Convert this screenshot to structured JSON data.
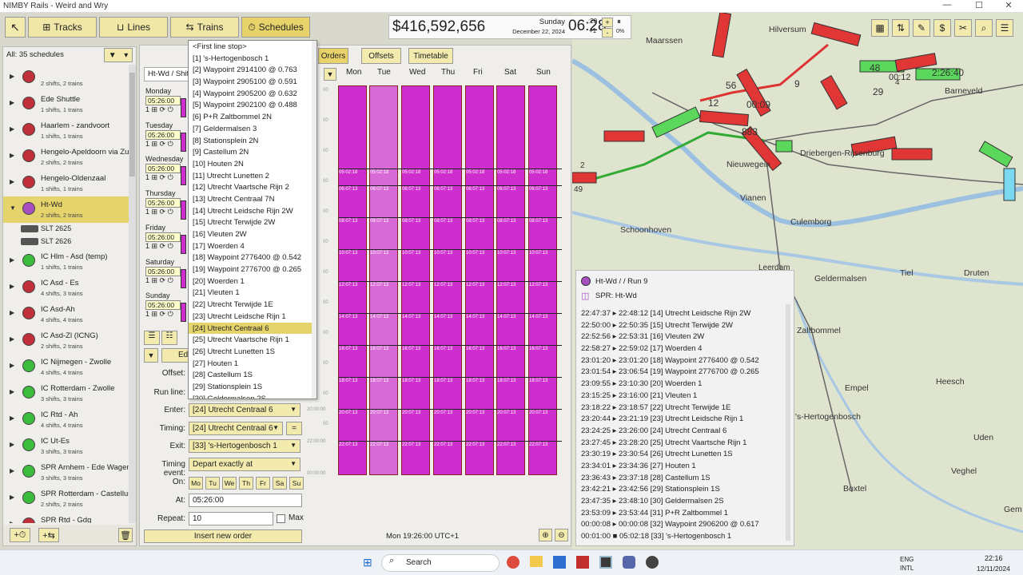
{
  "window": {
    "title": "NIMBY Rails - Weird and Wry"
  },
  "toolbar": {
    "tabs": [
      "Tracks",
      "Lines",
      "Trains",
      "Schedules"
    ],
    "active": "Schedules"
  },
  "finance": {
    "money": "$416,592,656",
    "weekday": "Sunday",
    "date": "December 22, 2024",
    "time": "06:28",
    "seconds": ":20",
    "speed": "+1",
    "pct": "0%"
  },
  "left_panel": {
    "header": "All: 35 schedules",
    "items": [
      {
        "name": "",
        "sub": "2 shifts, 2 trains",
        "color": "red"
      },
      {
        "name": "Ede Shuttle",
        "sub": "1 shifts, 1 trains",
        "color": "red"
      },
      {
        "name": "Haarlem - zandvoort",
        "sub": "1 shifts, 1 trains",
        "color": "red"
      },
      {
        "name": "Hengelo-Apeldoorn via Zut",
        "sub": "2 shifts, 2 trains",
        "color": "red"
      },
      {
        "name": "Hengelo-Oldenzaal",
        "sub": "1 shifts, 1 trains",
        "color": "red"
      },
      {
        "name": "Ht-Wd",
        "sub": "2 shifts, 2 trains",
        "color": "purple",
        "selected": true
      },
      {
        "name": "SLT 2625",
        "train": true
      },
      {
        "name": "SLT 2626",
        "train": true
      },
      {
        "name": "IC Hlm - Asd (temp)",
        "sub": "1 shifts, 1 trains",
        "color": "green"
      },
      {
        "name": "IC Asd - Es",
        "sub": "4 shifts, 3 trains",
        "color": "red"
      },
      {
        "name": "IC Asd-Ah",
        "sub": "4 shifts, 4 trains",
        "color": "red"
      },
      {
        "name": "IC Asd-Zl (ICNG)",
        "sub": "2 shifts, 2 trains",
        "color": "red"
      },
      {
        "name": "IC Nijmegen - Zwolle",
        "sub": "4 shifts, 4 trains",
        "color": "green"
      },
      {
        "name": "IC Rotterdam - Zwolle",
        "sub": "3 shifts, 3 trains",
        "color": "green"
      },
      {
        "name": "IC Rtd - Ah",
        "sub": "4 shifts, 4 trains",
        "color": "green"
      },
      {
        "name": "IC Ut-Es",
        "sub": "3 shifts, 3 trains",
        "color": "green"
      },
      {
        "name": "SPR Arnhem - Ede Wagenin",
        "sub": "3 shifts, 3 trains",
        "color": "green"
      },
      {
        "name": "SPR Rotterdam - Castellum",
        "sub": "2 shifts, 2 trains",
        "color": "green"
      },
      {
        "name": "SPR Rtd - Gdg",
        "sub": "",
        "color": "red"
      }
    ]
  },
  "schedule": {
    "title": "Ht-Wd / Shift 1",
    "tabs": [
      "Orders",
      "Offsets",
      "Timetable"
    ],
    "days": [
      {
        "name": "Monday",
        "time": "05:26:00"
      },
      {
        "name": "Tuesday",
        "time": "05:26:00"
      },
      {
        "name": "Wednesday",
        "time": "05:26:00"
      },
      {
        "name": "Thursday",
        "time": "05:26:00"
      },
      {
        "name": "Friday",
        "time": "05:26:00"
      },
      {
        "name": "Saturday",
        "time": "05:26:00"
      },
      {
        "name": "Sunday",
        "time": "05:26:00"
      }
    ],
    "week_headers": [
      "Mon",
      "Tue",
      "Wed",
      "Thu",
      "Fri",
      "Sat",
      "Sun"
    ],
    "grid_times": [
      "05:02:18",
      "06:07:13",
      "08:07:13",
      "10:07:13",
      "12:07:13",
      "14:07:13",
      "16:07:13",
      "18:07:13",
      "20:07:13",
      "22:07:13"
    ],
    "tick_labels": [
      "00",
      "00",
      "00",
      "00",
      "00",
      "00",
      "00",
      "00",
      "00",
      "00",
      "00",
      "00",
      "20:00:00",
      "22:00:00",
      "00:00:00"
    ],
    "edit_label": "Edi",
    "form": {
      "offset_label": "Offset:",
      "runline_label": "Run line:",
      "enter_label": "Enter:",
      "enter": "[24] Utrecht Centraal 6",
      "timing_label": "Timing:",
      "timing": "[24] Utrecht Centraal 6",
      "timing_eq": "=",
      "exit_label": "Exit:",
      "exit": "[33] 's-Hertogenbosch 1",
      "event_label": "Timing event:",
      "event": "Depart exactly at",
      "on_label": "On:",
      "dow": [
        "Mo",
        "Tu",
        "We",
        "Th",
        "Fr",
        "Sa",
        "Su"
      ],
      "at_label": "At:",
      "at": "05:26:00",
      "repeat_label": "Repeat:",
      "repeat": "10",
      "max_label": "Max"
    },
    "insert_label": "Insert new order",
    "status": "Mon 19:26:00 UTC+1"
  },
  "dropdown": {
    "options": [
      "<First line stop>",
      "[1] 's-Hertogenbosch 1",
      "[2] Waypoint 2914100 @ 0.763",
      "[3] Waypoint 2905100 @ 0.591",
      "[4] Waypoint 2905200 @ 0.632",
      "[5] Waypoint 2902100 @ 0.488",
      "[6] P+R Zaltbommel 2N",
      "[7] Geldermalsen 3",
      "[8] Stationsplein 2N",
      "[9] Castellum 2N",
      "[10] Houten 2N",
      "[11] Utrecht Lunetten 2",
      "[12] Utrecht Vaartsche Rijn 2",
      "[13] Utrecht Centraal 7N",
      "[14] Utrecht Leidsche Rijn 2W",
      "[15] Utrecht Terwijde 2W",
      "[16] Vleuten 2W",
      "[17] Woerden 4",
      "[18] Waypoint 2776400 @ 0.542",
      "[19] Waypoint 2776700 @ 0.265",
      "[20] Woerden 1",
      "[21] Vleuten 1",
      "[22] Utrecht Terwijde 1E",
      "[23] Utrecht Leidsche Rijn 1",
      "[24] Utrecht Centraal 6",
      "[25] Utrecht Vaartsche Rijn 1",
      "[26] Utrecht Lunetten 1S",
      "[27] Houten 1",
      "[28] Castellum 1S",
      "[29] Stationsplein 1S",
      "[30] Geldermalsen 2S"
    ],
    "selected": "[24] Utrecht Centraal 6"
  },
  "run": {
    "title": "Ht-Wd / / Run 9",
    "line": "SPR: Ht-Wd",
    "rows": [
      "22:47:37 ▸ 22:48:12 [14] Utrecht Leidsche Rijn 2W",
      "22:50:00 ▸ 22:50:35 [15] Utrecht Terwijde 2W",
      "22:52:56 ▸ 22:53:31 [16] Vleuten 2W",
      "22:58:27 ▸ 22:59:02 [17] Woerden 4",
      "23:01:20 ▸ 23:01:20 [18] Waypoint 2776400 @ 0.542",
      "23:01:54 ▸ 23:06:54 [19] Waypoint 2776700 @ 0.265",
      "23:09:55 ▸ 23:10:30 [20] Woerden 1",
      "23:15:25 ▸ 23:16:00 [21] Vleuten 1",
      "23:18:22 ▸ 23:18:57 [22] Utrecht Terwijde 1E",
      "23:20:44 ▸ 23:21:19 [23] Utrecht Leidsche Rijn 1",
      "23:24:25 ▸ 23:26:00 [24] Utrecht Centraal 6",
      "23:27:45 ▸ 23:28:20 [25] Utrecht Vaartsche Rijn 1",
      "23:30:19 ▸ 23:30:54 [26] Utrecht Lunetten 1S",
      "23:34:01 ▸ 23:34:36 [27] Houten 1",
      "23:36:43 ▸ 23:37:18 [28] Castellum 1S",
      "23:42:21 ▸ 23:42:56 [29] Stationsplein 1S",
      "23:47:35 ▸ 23:48:10 [30] Geldermalsen 2S",
      "23:53:09 ▸ 23:53:44 [31] P+R Zaltbommel 1",
      "00:00:08 ▸ 00:00:08 [32] Waypoint 2906200 @ 0.617",
      "00:01:00 ■ 05:02:18 [33] 's-Hertogenbosch 1"
    ]
  },
  "map": {
    "labels": [
      "Hilversum",
      "Barneveld",
      "Maarssen",
      "Driebergen-Rijsenburg",
      "Nieuwegein",
      "Vianen",
      "Culemborg",
      "Schoonhoven",
      "Geldermalsen",
      "Tiel",
      "Druten",
      "Zaltbommel",
      "Heesch",
      "Empel",
      "'s-Hertogenbosch",
      "Uden",
      "Boxtel",
      "Veghel",
      "Leerdam",
      "Gem"
    ],
    "train_labels": [
      "2",
      "49",
      "48",
      "29",
      "56",
      "12",
      "00:09",
      "883",
      "9",
      "4",
      "2:26:40",
      "00:12"
    ]
  },
  "taskbar": {
    "search": "Search",
    "lang1": "ENG",
    "lang2": "INTL",
    "time": "22:16",
    "date": "12/11/2024"
  }
}
